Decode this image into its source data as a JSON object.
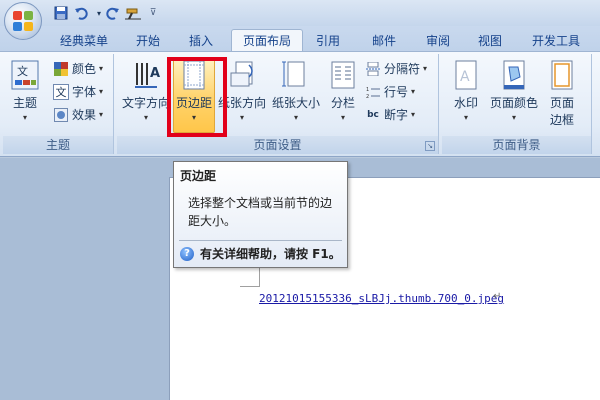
{
  "quick_access": {
    "icons": [
      "save-icon",
      "undo-icon",
      "redo-icon",
      "format-painter-icon",
      "customize-icon"
    ]
  },
  "tabs": [
    {
      "label": "经典菜单"
    },
    {
      "label": "开始"
    },
    {
      "label": "插入"
    },
    {
      "label": "页面布局",
      "active": true
    },
    {
      "label": "引用"
    },
    {
      "label": "邮件"
    },
    {
      "label": "审阅"
    },
    {
      "label": "视图"
    },
    {
      "label": "开发工具"
    }
  ],
  "groups": {
    "theme": {
      "label": "主题",
      "themes_button": "主题",
      "colors": "颜色",
      "fonts": "字体",
      "effects": "效果",
      "font_icon_glyph": "文"
    },
    "page_setup": {
      "label": "页面设置",
      "text_direction": "文字方向",
      "margins": "页边距",
      "orientation": "纸张方向",
      "size": "纸张大小",
      "columns": "分栏",
      "breaks": "分隔符",
      "line_numbers": "行号",
      "hyphenation": "断字",
      "hyphenation_icon_glyph": "bc"
    },
    "page_background": {
      "label": "页面背景",
      "watermark": "水印",
      "page_color": "页面颜色",
      "page_borders_line1": "页面",
      "page_borders_line2": "边框"
    }
  },
  "tooltip": {
    "title": "页边距",
    "body": "选择整个文档或当前节的边距大小。",
    "help": "有关详细帮助，请按 F1。"
  },
  "document": {
    "link_text": "20121015155336_sLBJj.thumb.700_0.jpeg",
    "paragraph_mark": "↵"
  },
  "colors": {
    "highlight_box": "#e2001a",
    "active_button": "#ffd36b"
  }
}
